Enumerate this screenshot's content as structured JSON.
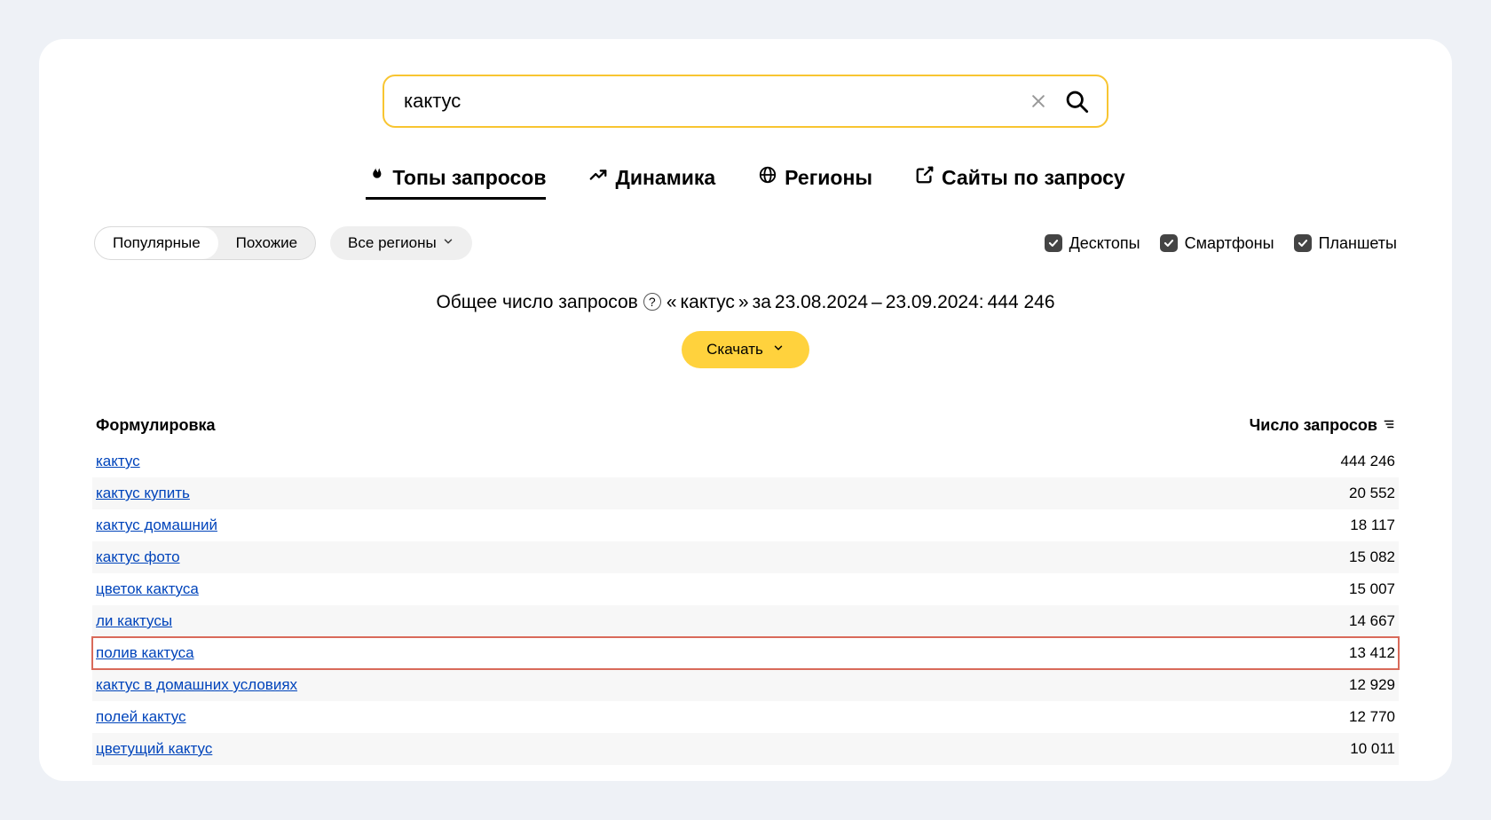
{
  "search": {
    "value": "кактус"
  },
  "tabs": [
    {
      "label": "Топы запросов",
      "icon": "flame",
      "active": true
    },
    {
      "label": "Динамика",
      "icon": "trend",
      "active": false
    },
    {
      "label": "Регионы",
      "icon": "globe",
      "active": false
    },
    {
      "label": "Сайты по запросу",
      "icon": "external",
      "active": false
    }
  ],
  "segment": {
    "popular": "Популярные",
    "similar": "Похожие",
    "selected": "popular"
  },
  "region_pill": "Все регионы",
  "devices": {
    "desktop": {
      "label": "Десктопы",
      "checked": true
    },
    "smartphone": {
      "label": "Смартфоны",
      "checked": true
    },
    "tablet": {
      "label": "Планшеты",
      "checked": true
    }
  },
  "summary": {
    "prefix": "Общее число запросов",
    "term_open": "«",
    "term": "кактус",
    "term_close": "»",
    "za": "за",
    "date_from": "23.08.2024",
    "dash": "–",
    "date_to": "23.09.2024:",
    "total": "444 246"
  },
  "download_label": "Скачать",
  "table": {
    "head_query": "Формулировка",
    "head_count": "Число запросов",
    "rows": [
      {
        "query": "кактус",
        "count": "444 246",
        "highlight": false
      },
      {
        "query": "кактус купить",
        "count": "20 552",
        "highlight": false
      },
      {
        "query": "кактус домашний",
        "count": "18 117",
        "highlight": false
      },
      {
        "query": "кактус фото",
        "count": "15 082",
        "highlight": false
      },
      {
        "query": "цветок кактуса",
        "count": "15 007",
        "highlight": false
      },
      {
        "query": "ли кактусы",
        "count": "14 667",
        "highlight": false
      },
      {
        "query": "полив кактуса",
        "count": "13 412",
        "highlight": true
      },
      {
        "query": "кактус в домашних условиях",
        "count": "12 929",
        "highlight": false
      },
      {
        "query": "полей кактус",
        "count": "12 770",
        "highlight": false
      },
      {
        "query": "цветущий кактус",
        "count": "10 011",
        "highlight": false
      }
    ]
  }
}
